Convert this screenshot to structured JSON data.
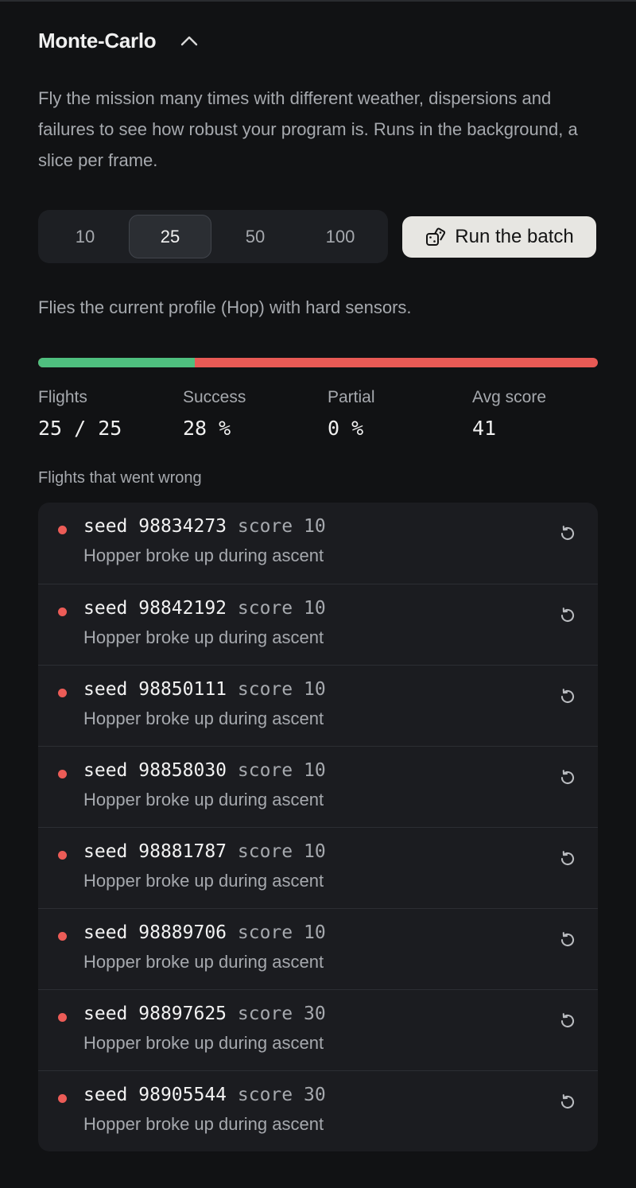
{
  "section": {
    "title": "Monte-Carlo",
    "description": "Fly the mission many times with different weather, dispersions and failures to see how robust your program is. Runs in the background, a slice per frame.",
    "collapse_icon": "chevron-up-icon"
  },
  "batch_sizes": {
    "options": [
      "10",
      "25",
      "50",
      "100"
    ],
    "selected": "25"
  },
  "run_button": {
    "label": "Run the batch",
    "icon": "dice-icon"
  },
  "profile_note": "Flies the current profile (Hop) with hard sensors.",
  "progress": {
    "success_fraction": 0.28,
    "colors": {
      "success": "#4fbf7f",
      "failure": "#e85a55"
    }
  },
  "stats": {
    "flights": {
      "label": "Flights",
      "value": "25 / 25"
    },
    "success": {
      "label": "Success",
      "value": "28 %"
    },
    "partial": {
      "label": "Partial",
      "value": "0 %"
    },
    "avg_score": {
      "label": "Avg score",
      "value": "41"
    }
  },
  "failures": {
    "title": "Flights that went wrong",
    "seed_word": "seed",
    "score_word": "score",
    "retry_icon": "retry-icon",
    "items": [
      {
        "seed": "98834273",
        "score": "10",
        "message": "Hopper broke up during ascent"
      },
      {
        "seed": "98842192",
        "score": "10",
        "message": "Hopper broke up during ascent"
      },
      {
        "seed": "98850111",
        "score": "10",
        "message": "Hopper broke up during ascent"
      },
      {
        "seed": "98858030",
        "score": "10",
        "message": "Hopper broke up during ascent"
      },
      {
        "seed": "98881787",
        "score": "10",
        "message": "Hopper broke up during ascent"
      },
      {
        "seed": "98889706",
        "score": "10",
        "message": "Hopper broke up during ascent"
      },
      {
        "seed": "98897625",
        "score": "30",
        "message": "Hopper broke up during ascent"
      },
      {
        "seed": "98905544",
        "score": "30",
        "message": "Hopper broke up during ascent"
      }
    ]
  }
}
